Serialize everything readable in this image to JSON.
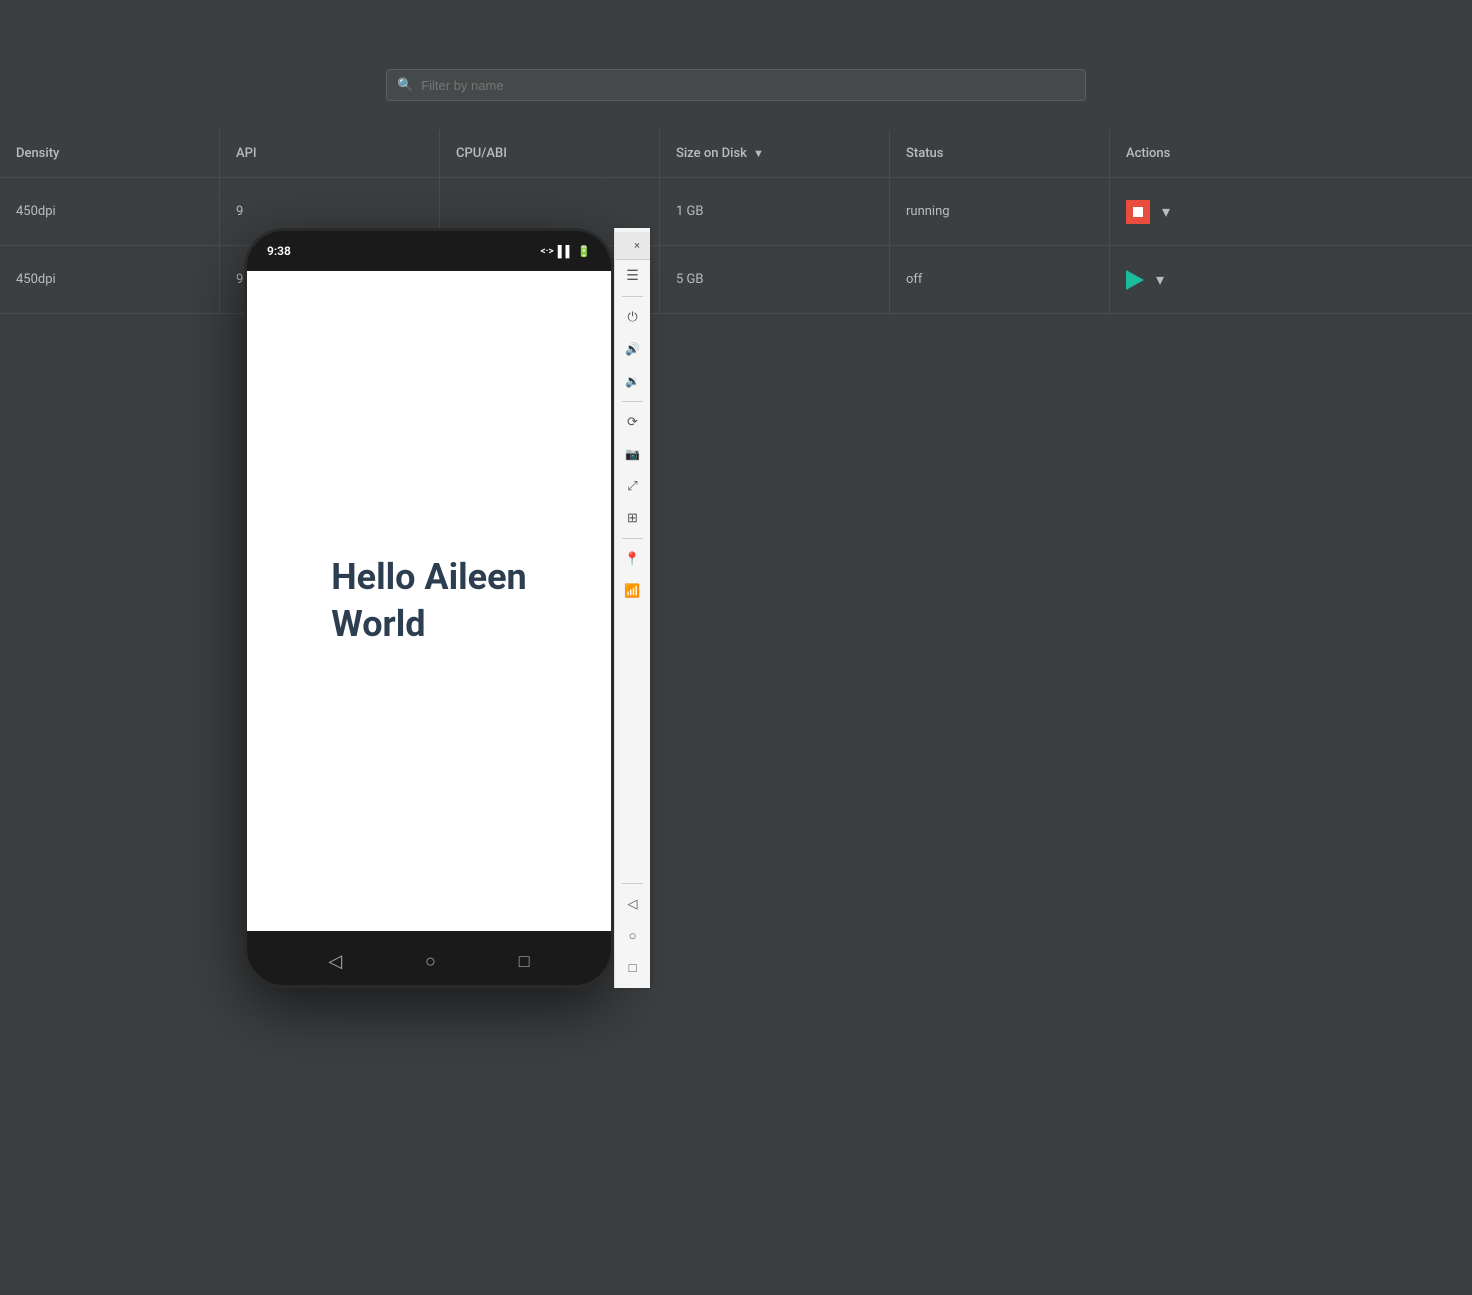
{
  "search": {
    "placeholder": "Filter by name"
  },
  "table": {
    "columns": [
      {
        "id": "density",
        "label": "Density",
        "sortable": false
      },
      {
        "id": "api",
        "label": "API",
        "sortable": false
      },
      {
        "id": "cpu_abi",
        "label": "CPU/ABI",
        "sortable": false
      },
      {
        "id": "size_on_disk",
        "label": "Size on Disk",
        "sortable": true
      },
      {
        "id": "status",
        "label": "Status",
        "sortable": false
      },
      {
        "id": "actions",
        "label": "Actions",
        "sortable": false
      }
    ],
    "rows": [
      {
        "density": "450dpi",
        "api": "9",
        "cpu_abi": "",
        "size_on_disk": "1 GB",
        "status": "running",
        "action_type": "stop"
      },
      {
        "density": "450dpi",
        "api": "9",
        "cpu_abi": "",
        "size_on_disk": "5 GB",
        "status": "off",
        "action_type": "play"
      }
    ]
  },
  "emulator": {
    "time": "9:38",
    "screen_text_line1": "Hello Aileen",
    "screen_text_line2": "World"
  },
  "sidebar_controls": {
    "close_label": "×",
    "menu_icon": "☰",
    "power_icon": "⏻",
    "vol_up_icon": "🔊",
    "vol_down_icon": "🔉",
    "rotate_icon": "⟳",
    "screenshot_icon": "📋",
    "resize_icon": "⤢",
    "fold_icon": "⊞",
    "location_icon": "◎",
    "wifi_icon": "⌘"
  },
  "colors": {
    "background": "#3c3f41",
    "stop_red": "#e74c3c",
    "play_green": "#1abc9c",
    "text_primary": "#bbbbbb",
    "border": "#4a4d4e"
  }
}
